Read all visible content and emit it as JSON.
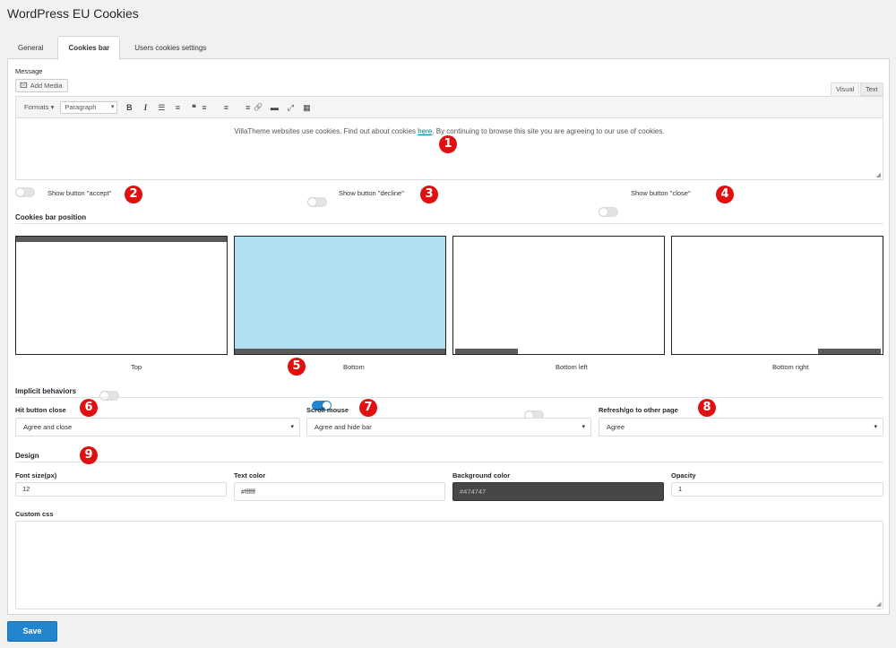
{
  "page_title": "WordPress EU Cookies",
  "tabs": [
    {
      "label": "General"
    },
    {
      "label": "Cookies bar"
    },
    {
      "label": "Users cookies settings"
    }
  ],
  "message": {
    "label": "Message",
    "add_media_label": "Add Media",
    "mode_tabs": [
      {
        "label": "Visual"
      },
      {
        "label": "Text"
      }
    ],
    "toolbar": {
      "formats_label": "Formats ▾",
      "paragraph_value": "Paragraph",
      "buttons": [
        {
          "name": "bold-icon",
          "glyph": "B"
        },
        {
          "name": "italic-icon",
          "glyph": "I"
        },
        {
          "name": "bullet-list-icon",
          "glyph": "☰"
        },
        {
          "name": "numbered-list-icon",
          "glyph": "≡"
        },
        {
          "name": "quote-icon",
          "glyph": "❝"
        },
        {
          "name": "align-left-icon",
          "glyph": "≡"
        },
        {
          "name": "align-center-icon",
          "glyph": "≡"
        },
        {
          "name": "align-right-icon",
          "glyph": "≡"
        },
        {
          "name": "link-icon",
          "glyph": "🔗"
        },
        {
          "name": "read-more-icon",
          "glyph": "▬"
        },
        {
          "name": "fullscreen-icon",
          "glyph": "⤢"
        },
        {
          "name": "toolbar-toggle-icon",
          "glyph": "▦"
        }
      ]
    },
    "content_before": "VillaTheme websites use cookies. Find out about cookies ",
    "content_link": "here",
    "content_after": ". By continuing to browse this site you are agreeing to our use of cookies."
  },
  "buttons_toggles": [
    {
      "label": "Show button \"accept\"",
      "on": false
    },
    {
      "label": "Show button \"decline\"",
      "on": false
    },
    {
      "label": "Show button \"close\"",
      "on": false
    }
  ],
  "position": {
    "title": "Cookies bar position",
    "options": [
      {
        "label": "Top",
        "on": false
      },
      {
        "label": "Bottom",
        "on": true
      },
      {
        "label": "Bottom left",
        "on": false
      },
      {
        "label": "Bottom right",
        "on": false
      }
    ],
    "active_color": "#b0e0ef",
    "bar_color": "#5a5a5a"
  },
  "implicit": {
    "title": "Implicit behaviors",
    "fields": [
      {
        "label": "Hit button close",
        "value": "Agree and close"
      },
      {
        "label": "Scroll mouse",
        "value": "Agree and hide bar"
      },
      {
        "label": "Refresh/go to other page",
        "value": "Agree"
      }
    ]
  },
  "design": {
    "title": "Design",
    "font_size": {
      "label": "Font size(px)",
      "value": "12"
    },
    "text_color": {
      "label": "Text color",
      "value": "#ffffff"
    },
    "background_color": {
      "label": "Background color",
      "value": "#474747"
    },
    "opacity": {
      "label": "Opacity",
      "value": "1"
    },
    "custom_css": {
      "label": "Custom css",
      "value": ""
    }
  },
  "badges": [
    "1",
    "2",
    "3",
    "4",
    "5",
    "6",
    "7",
    "8",
    "9"
  ],
  "save_label": "Save",
  "colors": {
    "accent": "#2185d0",
    "badge": "#e01010"
  }
}
